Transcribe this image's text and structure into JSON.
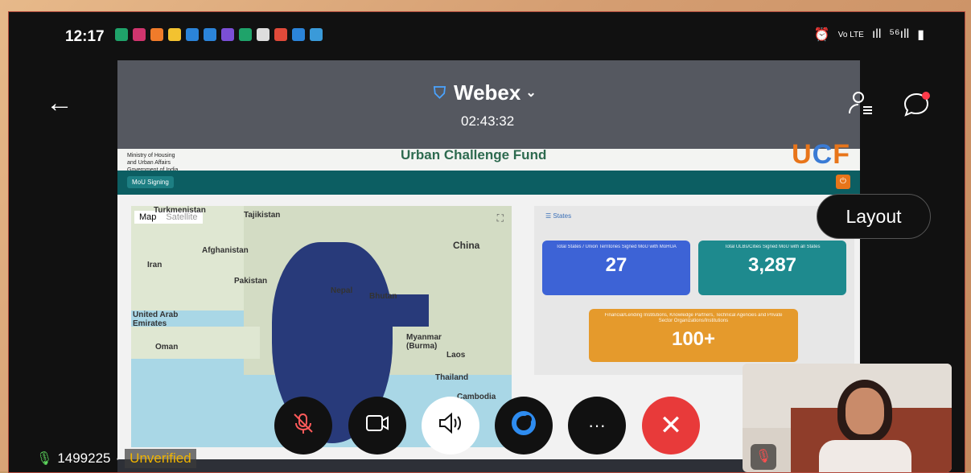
{
  "status_bar": {
    "time": "12:17",
    "right_indicators": [
      "⏰",
      "Vo LTE",
      "ıll",
      "⁵⁶ıll",
      "▮"
    ]
  },
  "shared_page": {
    "org_line1": "Ministry of Housing",
    "org_line2": "and Urban Affairs",
    "org_line3": "Government of India",
    "site_title": "Urban Challenge Fund",
    "logo": {
      "u": "U",
      "c": "C",
      "f": "F"
    },
    "tag": "MoU Signing",
    "map": {
      "tabs": [
        "Map",
        "Satellite"
      ],
      "labels": [
        "Turkmenistan",
        "Tajikistan",
        "Afghanistan",
        "Iran",
        "Pakistan",
        "China",
        "Nepal",
        "Bhutan",
        "United Arab Emirates",
        "Oman",
        "Myanmar (Burma)",
        "Laos",
        "Thailand",
        "Cambodia"
      ]
    },
    "stats": {
      "header": "☰ States",
      "cards": [
        {
          "caption": "Total States / Union Territories Signed MoU with MoHUA",
          "value": "27"
        },
        {
          "caption": "Total ULBs/Cities Signed MoU with all States",
          "value": "3,287"
        },
        {
          "caption": "Financial/Lending Institutions, Knowledge Partners, Technical Agencies and Private Sector Organizations/Institutions",
          "value": "100+"
        }
      ]
    }
  },
  "webex": {
    "title": "Webex",
    "timer": "02:43:32",
    "layout_button": "Layout",
    "meeting_id": "1499225",
    "separator": "·",
    "verification": "Unverified",
    "colors": {
      "leave": "#e83a3a",
      "accent": "#4aa3ff",
      "unverified": "#f0b400"
    }
  }
}
